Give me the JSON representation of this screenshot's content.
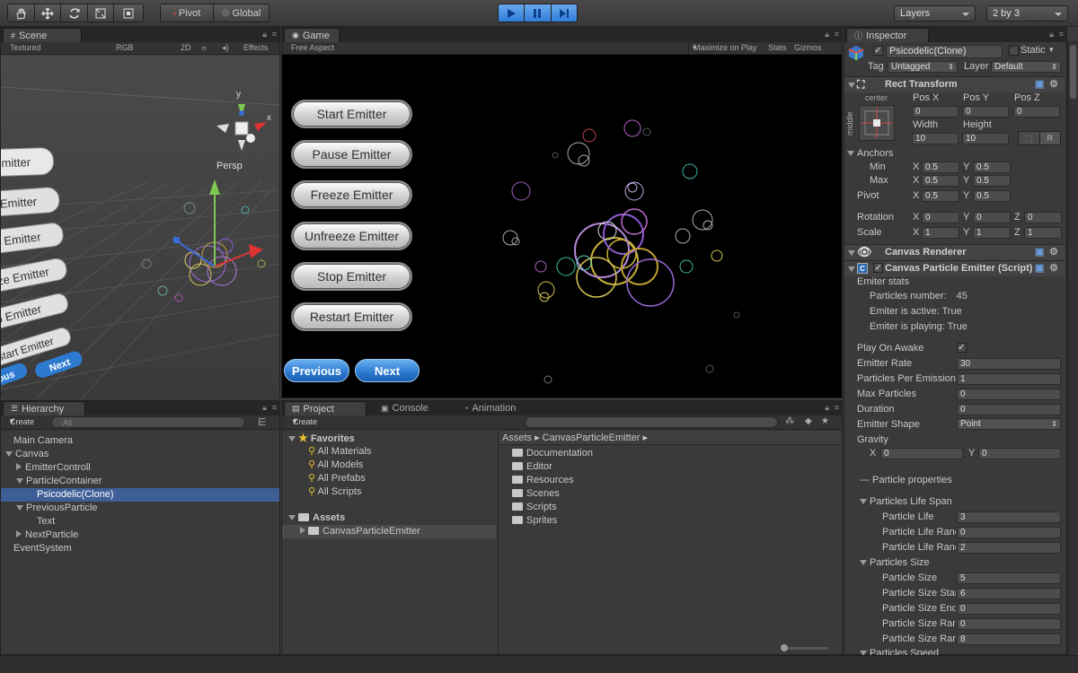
{
  "toolbar": {
    "pivot": "Pivot",
    "global": "Global",
    "layers": "Layers",
    "layout": "2 by 3"
  },
  "scene": {
    "tab": "Scene",
    "shading": "Textured",
    "render_mode": "RGB",
    "mode_2d": "2D",
    "effects": "Effects",
    "persp": "Persp",
    "axis_y": "y",
    "axis_x": "x",
    "labels": [
      "mitter",
      "Emitter",
      "Emitter",
      "ze Emitter",
      "p Emitter",
      "start Emitter",
      "ous",
      "Next"
    ]
  },
  "game": {
    "tab": "Game",
    "aspect": "Free Aspect",
    "maximize": "Maximize on Play",
    "stats": "Stats",
    "gizmos": "Gizmos",
    "buttons": [
      "Start Emitter",
      "Pause Emitter",
      "Freeze Emitter",
      "Unfreeze Emitter",
      "Stop Emitter",
      "Restart Emitter"
    ],
    "previous": "Previous",
    "next": "Next"
  },
  "hierarchy": {
    "tab": "Hierarchy",
    "create": "Create",
    "search_placeholder": "All",
    "items": [
      "Main Camera",
      "Canvas",
      "EmitterControll",
      "ParticleContainer",
      "Psicodelic(Clone)",
      "PreviousParticle",
      "Text",
      "NextParticle",
      "EventSystem"
    ]
  },
  "project": {
    "tab": "Project",
    "console_tab": "Console",
    "animation_tab": "Animation",
    "create": "Create",
    "favorites": "Favorites",
    "favorite_items": [
      "All Materials",
      "All Models",
      "All Prefabs",
      "All Scripts"
    ],
    "assets": "Assets",
    "asset_tree_child": "CanvasParticleEmitter",
    "breadcrumb": [
      "Assets",
      "CanvasParticleEmitter"
    ],
    "folders": [
      "Documentation",
      "Editor",
      "Resources",
      "Scenes",
      "Scripts",
      "Sprites"
    ]
  },
  "inspector": {
    "tab": "Inspector",
    "object_name": "Psicodelic(Clone)",
    "static": "Static",
    "tag_label": "Tag",
    "tag_value": "Untagged",
    "layer_label": "Layer",
    "layer_value": "Default",
    "rect_transform": {
      "title": "Rect Transform",
      "anchor_h": "center",
      "anchor_v": "middle",
      "pos_labels": [
        "Pos X",
        "Pos Y",
        "Pos Z"
      ],
      "pos_values": [
        "0",
        "0",
        "0"
      ],
      "size_labels": [
        "Width",
        "Height"
      ],
      "size_values": [
        "10",
        "10"
      ],
      "r_button": "R",
      "anchors": "Anchors",
      "min": "Min",
      "max": "Max",
      "pivot": "Pivot",
      "x": "X",
      "y": "Y",
      "z": "Z",
      "min_values": [
        "0.5",
        "0.5"
      ],
      "max_values": [
        "0.5",
        "0.5"
      ],
      "pivot_values": [
        "0.5",
        "0.5"
      ],
      "rotation": "Rotation",
      "rotation_values": [
        "0",
        "0",
        "0"
      ],
      "scale": "Scale",
      "scale_values": [
        "1",
        "1",
        "1"
      ]
    },
    "canvas_renderer": "Canvas Renderer",
    "emitter": {
      "title": "Canvas Particle Emitter (Script)",
      "stats": "Emiter stats",
      "particles_number_label": "Particles number:",
      "particles_number": "45",
      "is_active": "Emiter is active: True",
      "is_playing": "Emiter is playing: True",
      "fields": [
        {
          "label": "Play On Awake",
          "value": "✓"
        },
        {
          "label": "Emitter Rate",
          "value": "30"
        },
        {
          "label": "Particles Per Emission",
          "value": "1"
        },
        {
          "label": "Max Particles",
          "value": "0"
        },
        {
          "label": "Duration",
          "value": "0"
        },
        {
          "label": "Emitter Shape",
          "value": "Point"
        }
      ],
      "gravity": "Gravity",
      "gravity_x": "0",
      "gravity_y": "0",
      "particle_properties": "--- Particle properties",
      "life_span": "Particles Life Span",
      "life_fields": [
        {
          "label": "Particle Life",
          "value": "3"
        },
        {
          "label": "Particle Life Ranc",
          "value": "0"
        },
        {
          "label": "Particle Life Ranc",
          "value": "2"
        }
      ],
      "size_group": "Particles Size",
      "size_fields": [
        {
          "label": "Particle Size",
          "value": "5"
        },
        {
          "label": "Particle Size Star",
          "value": "6"
        },
        {
          "label": "Particle Size End",
          "value": "0"
        },
        {
          "label": "Particle Size Ran",
          "value": "0"
        },
        {
          "label": "Particle Size Ran",
          "value": "8"
        }
      ],
      "speed_group": "Particles Speed"
    }
  },
  "colors": {
    "selection": "#3d5f96",
    "play_active": "#3a8ee6"
  }
}
